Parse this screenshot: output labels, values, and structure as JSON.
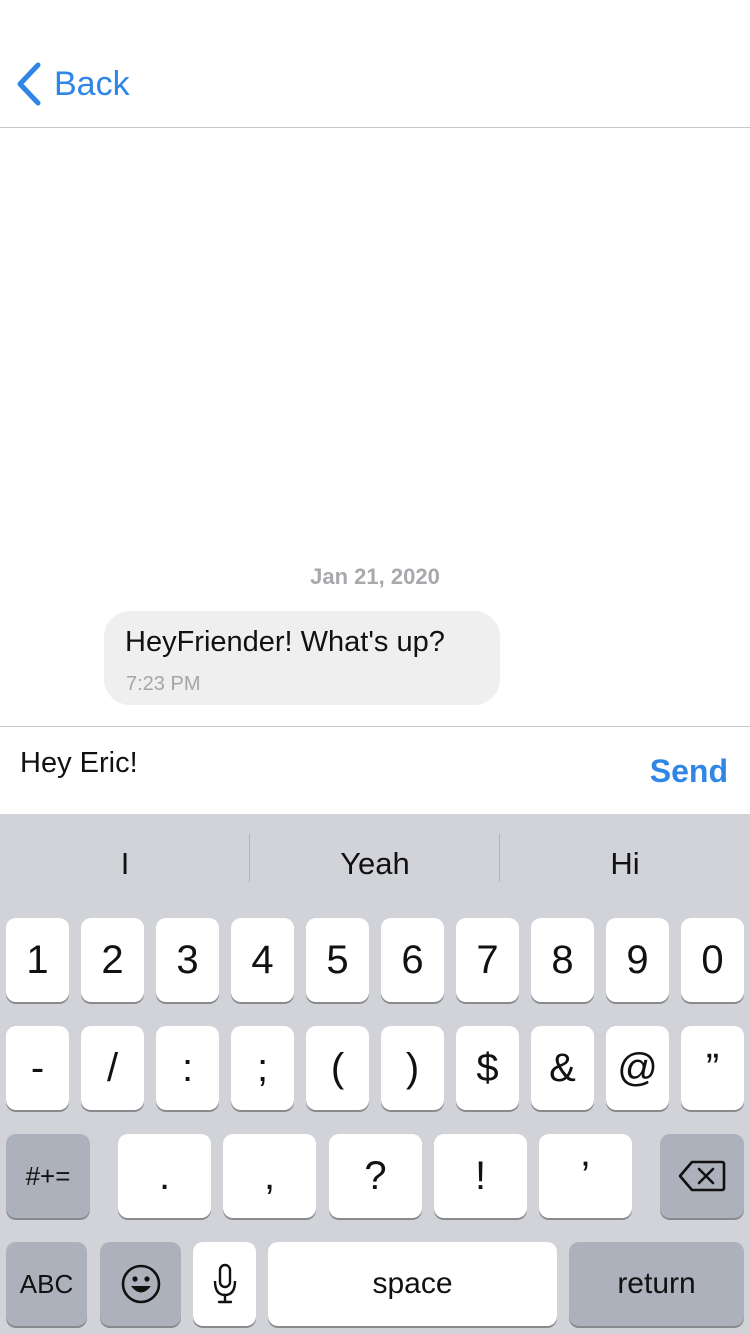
{
  "nav": {
    "back_label": "Back"
  },
  "chat": {
    "date": "Jan 21, 2020",
    "messages": [
      {
        "text": "HeyFriender! What's up?",
        "time": "7:23 PM"
      }
    ]
  },
  "composer": {
    "value": "Hey Eric!",
    "send_label": "Send"
  },
  "keyboard": {
    "suggestions": [
      "I",
      "Yeah",
      "Hi"
    ],
    "row1": [
      "1",
      "2",
      "3",
      "4",
      "5",
      "6",
      "7",
      "8",
      "9",
      "0"
    ],
    "row2": [
      "-",
      "/",
      ":",
      ";",
      "(",
      ")",
      "$",
      "&",
      "@",
      "”"
    ],
    "row3": {
      "mode": "#+=",
      "keys": [
        ".",
        ",",
        "?",
        "!",
        "’"
      ],
      "delete": "delete-icon"
    },
    "row4": {
      "abc": "ABC",
      "emoji": "emoji-icon",
      "mic": "microphone-icon",
      "space": "space",
      "return": "return"
    }
  },
  "colors": {
    "accent": "#2f86e6",
    "keyboard_bg": "#d1d3d9",
    "bubble_bg": "#efefef"
  }
}
